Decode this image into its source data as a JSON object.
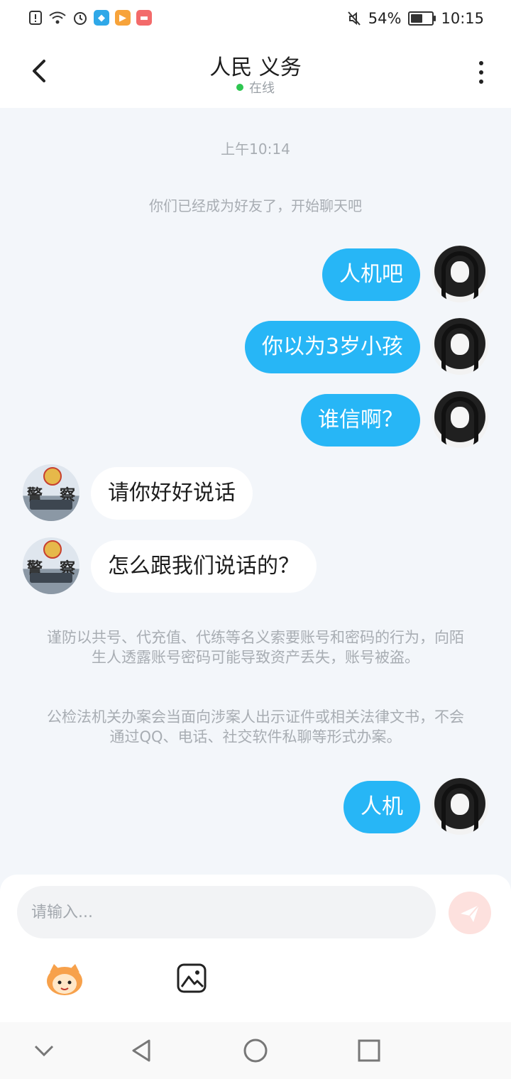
{
  "status_bar": {
    "battery_percent": "54%",
    "time": "10:15",
    "battery_level": 0.54
  },
  "header": {
    "title": "人民 义务",
    "status": "在线"
  },
  "chat": {
    "timestamp": "上午10:14",
    "system_message": "你们已经成为好友了，开始聊天吧",
    "messages": [
      {
        "side": "out",
        "text": "人机吧"
      },
      {
        "side": "out",
        "text": "你以为3岁小孩"
      },
      {
        "side": "out",
        "text": "谁信啊？"
      },
      {
        "side": "in",
        "text": "请你好好说话"
      },
      {
        "side": "in",
        "text": "怎么跟我们说话的？"
      },
      {
        "side": "out",
        "text": "人机"
      }
    ],
    "notice_1": "谨防以共号、代充值、代练等名义索要账号和密码的行为，向陌生人透露账号密码可能导致资产丢失，账号被盗。",
    "notice_2": "公检法机关办案会当面向涉案人出示证件或相关法律文书，不会通过QQ、电话、社交软件私聊等形式办案。",
    "avatar_in_chars": [
      "警",
      "察"
    ]
  },
  "composer": {
    "placeholder": "请输入..."
  },
  "colors": {
    "outgoing_bubble": "#27b6f6",
    "incoming_bubble": "#ffffff",
    "online_dot": "#2ec651",
    "send_button": "#fde1de",
    "background": "#f3f6fa"
  },
  "icons": {
    "back": "chevron-left-icon",
    "more": "vertical-dots-icon",
    "send": "paper-plane-icon",
    "emoji": "emoji-face-icon",
    "image": "image-icon"
  }
}
